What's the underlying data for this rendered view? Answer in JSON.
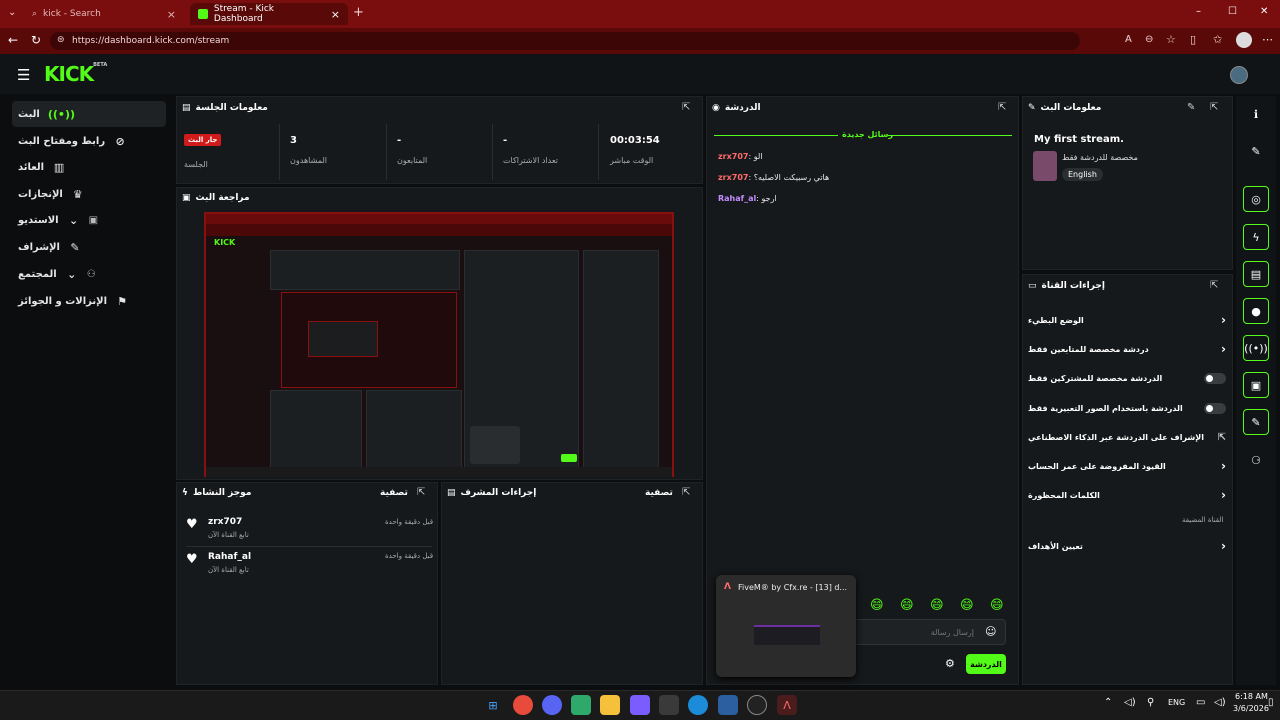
{
  "browser": {
    "tabs": [
      {
        "label": "kick - Search"
      },
      {
        "label": "Stream - Kick Dashboard"
      }
    ],
    "new_tab": "+",
    "url": "https://dashboard.kick.com/stream",
    "window_controls": [
      "–",
      "☐",
      "✕"
    ]
  },
  "header": {
    "logo": "KICK",
    "logo_badge": "BETA"
  },
  "sidebar": {
    "items": [
      {
        "label": "البث",
        "icon": "live-icon"
      },
      {
        "label": "رابط ومفتاح البث",
        "icon": "link-icon"
      },
      {
        "label": "العائد",
        "icon": "revenue-icon"
      },
      {
        "label": "الإنجازات",
        "icon": "trophy-icon"
      },
      {
        "label": "الاستديو",
        "icon": "studio-icon"
      },
      {
        "label": "الإشراف",
        "icon": "wrench-icon"
      },
      {
        "label": "المجتمع",
        "icon": "community-icon"
      },
      {
        "label": "الإنزالات و الجوائز",
        "icon": "drops-icon"
      }
    ]
  },
  "session": {
    "title": "معلومات الجلسة",
    "badge": "جار البث",
    "badge_label": "الجلسة",
    "stats": [
      {
        "value": "3",
        "label": "المشاهدون"
      },
      {
        "value": "-",
        "label": "المتابعون"
      },
      {
        "value": "-",
        "label": "تعداد الاشتراكات"
      },
      {
        "value": "00:03:54",
        "label": "الوقت مباشر"
      }
    ]
  },
  "preview": {
    "title": "مراجعة البث"
  },
  "activity": {
    "title": "موجز النشاط",
    "filter": "تصفية",
    "items": [
      {
        "name": "zrx707",
        "desc": "تابع القناة الآن",
        "time": "قبل دقيقة واحدة"
      },
      {
        "name": "Rahaf_al",
        "desc": "تابع القناة الآن",
        "time": "قبل دقيقة واحدة"
      }
    ]
  },
  "modactions": {
    "title": "إجراءات المشرف",
    "filter": "تصفية"
  },
  "chat": {
    "title": "الدردشة",
    "new_messages": "رسائل جديدة",
    "messages": [
      {
        "user": "zrx707",
        "text": "الو",
        "color": "#ff6b6b"
      },
      {
        "user": "zrx707",
        "text": "هاتي رسبيكت الاصليه؟",
        "color": "#ff6b6b"
      },
      {
        "user": "Rahaf_al",
        "text": "ارجو",
        "color": "#c58cff"
      }
    ],
    "input_placeholder": "إرسال رسالة",
    "send_label": "الدردشة",
    "emotes": [
      "😄",
      "😄",
      "😄",
      "😄",
      "😄"
    ],
    "popup_title": "FiveM® by Cfx.re - [13] d..."
  },
  "stream_info": {
    "title": "معلومات البث",
    "stream_title": "My first stream.",
    "subtitle": "مخصصة للدردشة فقط",
    "language": "English"
  },
  "channel_actions": {
    "title": "إجراءات القناة",
    "items": [
      {
        "label": "الوضع البطيء",
        "control": "chevron"
      },
      {
        "label": "دردشة مخصصة للمتابعين فقط",
        "control": "chevron"
      },
      {
        "label": "الدردشة مخصصة للمشتركين فقط",
        "control": "toggle"
      },
      {
        "label": "الدردشة باستخدام الصور التعبيرية فقط",
        "control": "toggle"
      },
      {
        "label": "الإشراف على الدردشة عبر الذكاء الاصطناعي",
        "control": "external"
      },
      {
        "label": "القيود المفروضة على عمر الحساب",
        "control": "chevron"
      },
      {
        "label": "الكلمات المحظورة",
        "control": "chevron"
      }
    ],
    "section_label": "القناة المضيفة",
    "goals_label": "تعيين الأهداف"
  },
  "taskbar": {
    "lang": "ENG",
    "time": "6:18 AM",
    "date": "3/6/2026"
  },
  "colors": {
    "accent": "#53fc18",
    "chrome": "#7a0e0e",
    "panel": "#16191b"
  }
}
